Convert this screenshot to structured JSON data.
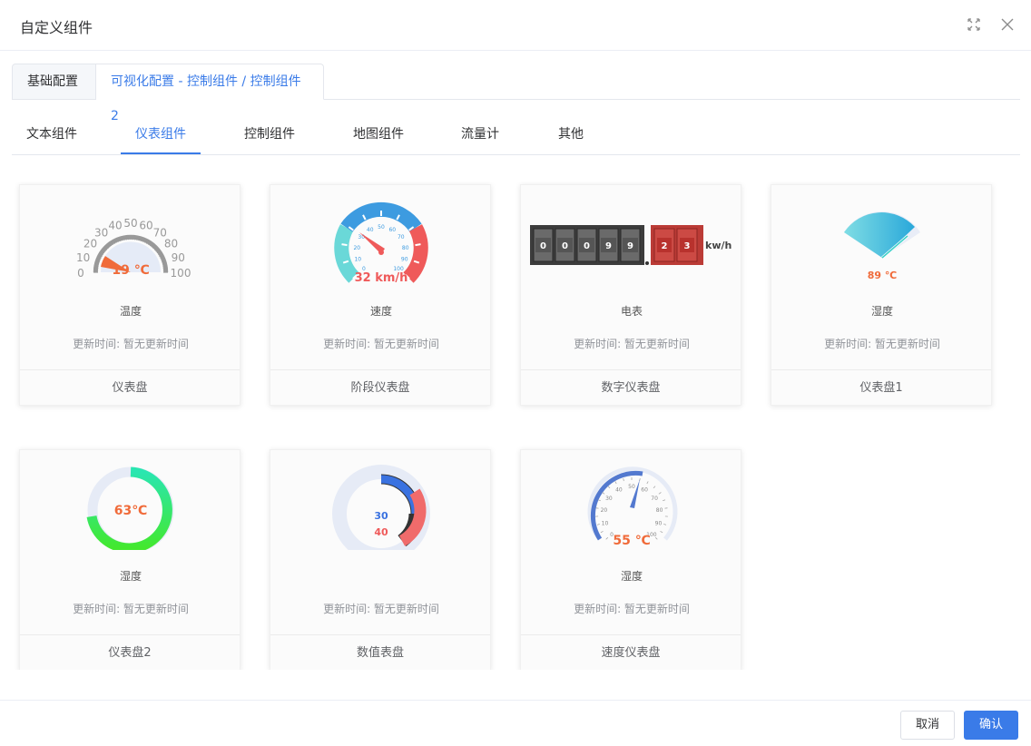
{
  "dialog": {
    "title": "自定义组件"
  },
  "top_tabs": [
    {
      "label": "基础配置"
    },
    {
      "label": "可视化配置 - 控制组件 / 控制组件2"
    }
  ],
  "sub_tabs": [
    {
      "label": "文本组件"
    },
    {
      "label": "仪表组件",
      "active": true
    },
    {
      "label": "控制组件"
    },
    {
      "label": "地图组件"
    },
    {
      "label": "流量计"
    },
    {
      "label": "其他"
    }
  ],
  "cards": [
    {
      "name": "温度",
      "update": "更新时间:  暂无更新时间",
      "footer": "仪表盘",
      "reading": "19 ℃",
      "scale": [
        "0",
        "10",
        "20",
        "30",
        "40",
        "50",
        "60",
        "70",
        "80",
        "90",
        "100"
      ]
    },
    {
      "name": "速度",
      "update": "更新时间:  暂无更新时间",
      "footer": "阶段仪表盘",
      "reading": "32 km/h",
      "scale": [
        "0",
        "10",
        "20",
        "30",
        "40",
        "50",
        "60",
        "70",
        "80",
        "90",
        "100"
      ]
    },
    {
      "name": "电表",
      "update": "更新时间:  暂无更新时间",
      "footer": "数字仪表盘",
      "digits": [
        "0",
        "0",
        "0",
        "9",
        "9"
      ],
      "decimals": [
        "2",
        "3"
      ],
      "unit": "kw/h"
    },
    {
      "name": "湿度",
      "update": "更新时间:  暂无更新时间",
      "footer": "仪表盘1",
      "reading": "89 ℃"
    },
    {
      "name": "湿度",
      "update": "更新时间:  暂无更新时间",
      "footer": "仪表盘2",
      "reading": "63℃"
    },
    {
      "name": "",
      "update": "更新时间:  暂无更新时间",
      "footer": "数值表盘",
      "value_a": "30",
      "value_b": "40"
    },
    {
      "name": "湿度",
      "update": "更新时间:  暂无更新时间",
      "footer": "速度仪表盘",
      "reading": "55 ℃",
      "scale": [
        "0",
        "10",
        "20",
        "30",
        "40",
        "50",
        "60",
        "70",
        "80",
        "90",
        "100"
      ]
    }
  ],
  "buttons": {
    "cancel": "取消",
    "confirm": "确认"
  },
  "colors": {
    "accent": "#3a7be8",
    "orange": "#f06b3a",
    "red": "#ef5a5a",
    "green": "#3ee43e",
    "cyan": "#5fd6de"
  },
  "icons": {
    "maximize": "expand-icon",
    "close": "close-icon"
  }
}
